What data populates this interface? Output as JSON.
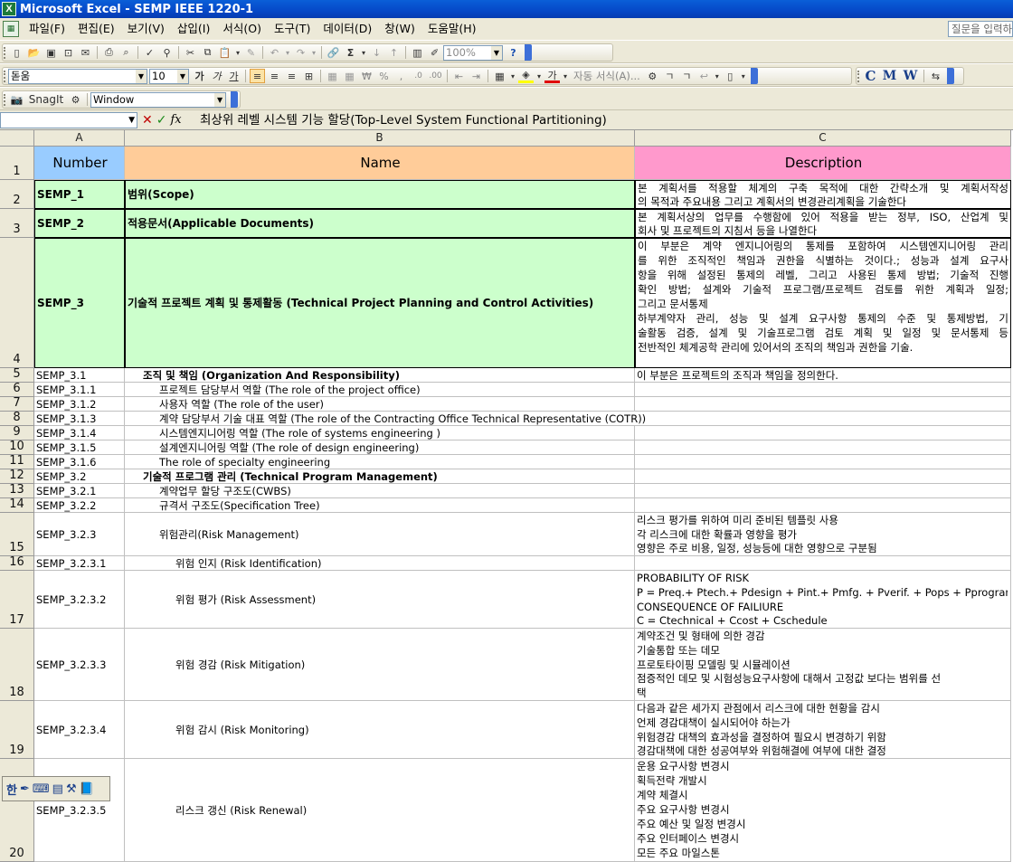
{
  "window": {
    "title": "Microsoft Excel - SEMP IEEE 1220-1"
  },
  "menu": {
    "items": [
      "파일(F)",
      "편집(E)",
      "보기(V)",
      "삽입(I)",
      "서식(O)",
      "도구(T)",
      "데이터(D)",
      "창(W)",
      "도움말(H)"
    ],
    "help_placeholder": "질문을 입력하"
  },
  "toolbar": {
    "zoom": "100%",
    "font": "돋움",
    "font_size": "10",
    "style_bold": "가",
    "style_italic": "가",
    "style_underline": "가",
    "currency": "₩",
    "percent": "%",
    "font_color_glyph": "가",
    "auto_format": "자동 서식(A)...",
    "cmw": [
      "C",
      "M",
      "W"
    ],
    "snagit_label": "SnagIt",
    "snagit_combo": "Window"
  },
  "formula_bar": {
    "name_box": "",
    "content": "최상위 레벨 시스템 기능 할당(Top-Level System Functional Partitioning)"
  },
  "columns": [
    "A",
    "B",
    "C"
  ],
  "header_row": {
    "number": "Number",
    "name": "Name",
    "description": "Description"
  },
  "colors": {
    "header_a": "#99ccff",
    "header_b": "#ffcc99",
    "header_c": "#ff99cc",
    "top_rows": "#ccffcc"
  },
  "rows": [
    {
      "row": "2",
      "number": "SEMP_1",
      "name": "범위(Scope)",
      "desc": [
        "본 계획서를 적용할 체계의 구축 목적에 대한 간략소개 및 계획서작성",
        "의 목적과 주요내용 그리고 계획서의 변경관리계획을 기술한다"
      ]
    },
    {
      "row": "3",
      "number": "SEMP_2",
      "name": "적용문서(Applicable Documents)",
      "desc": [
        "본 계획서상의 업무를 수행함에 있어 적용을 받는 정부, ISO, 산업계 및",
        "회사 및 프로젝트의 지침서 등을 나열한다"
      ]
    },
    {
      "row": "4",
      "number": "SEMP_3",
      "name": "기술적 프로젝트 계획 및 통제활동 (Technical Project Planning and Control Activities)",
      "desc": [
        "이 부분은 계약 엔지니어링의 통제를 포함하여 시스템엔지니어링 관리",
        "를 위한 조직적인 책임과 권한을 식별하는 것이다.; 성능과 설계 요구사",
        "항을 위해 설정된 통제의 레벨, 그리고 사용된 통제 방법; 기술적 진행",
        "확인 방법; 설계와 기술적 프로그램/프로젝트 검토를 위한 계획과 일정;",
        "그리고 문서통제",
        "하부계약자 관리, 성능 및 설계 요구사항 통제의 수준 및 통제방법, 기",
        "술활동 검증, 설계 및 기술프로그램 검토 계획 및 일정 및 문서통제 등",
        "전반적인 체계공학 관리에 있어서의  조직의 책임과 권한을 기술."
      ]
    },
    {
      "row": "5",
      "number": "SEMP_3.1",
      "name": "조직 및 책임 (Organization And Responsibility)",
      "desc": [
        "이 부분은 프로젝트의 조직과 책임을 정의한다."
      ]
    },
    {
      "row": "6",
      "number": "SEMP_3.1.1",
      "name": "프로젝트 담당부서 역할 (The role of the project office)",
      "desc": []
    },
    {
      "row": "7",
      "number": "SEMP_3.1.2",
      "name": "사용자 역할 (The role of the user)",
      "desc": []
    },
    {
      "row": "8",
      "number": "SEMP_3.1.3",
      "name": "계약 담당부서 기술 대표 역할 (The role of the Contracting Office Technical Representative (COTR))",
      "desc": []
    },
    {
      "row": "9",
      "number": "SEMP_3.1.4",
      "name": "시스템엔지니어링 역할 (The role of systems engineering )",
      "desc": []
    },
    {
      "row": "10",
      "number": "SEMP_3.1.5",
      "name": "설계엔지니어링 역할 (The role of design engineering)",
      "desc": []
    },
    {
      "row": "11",
      "number": "SEMP_3.1.6",
      "name": "The role of specialty engineering",
      "desc": []
    },
    {
      "row": "12",
      "number": "SEMP_3.2",
      "name": "기술적 프로그램 관리 (Technical Program Management)",
      "desc": []
    },
    {
      "row": "13",
      "number": "SEMP_3.2.1",
      "name": "계약업무 할당 구조도(CWBS)",
      "desc": []
    },
    {
      "row": "14",
      "number": "SEMP_3.2.2",
      "name": "규격서 구조도(Specification Tree)",
      "desc": []
    },
    {
      "row": "15",
      "number": "SEMP_3.2.3",
      "name": "위험관리(Risk Management)",
      "desc": [
        "리스크 평가를 위하여 미리 준비된 템플릿 사용",
        "각 리스크에 대한 확률과 영향을 평가",
        "영향은 주로 비용, 일정, 성능등에 대한 영향으로 구분됨"
      ]
    },
    {
      "row": "16",
      "number": "SEMP_3.2.3.1",
      "name": "위험 인지 (Risk Identification)",
      "desc": []
    },
    {
      "row": "17",
      "number": "SEMP_3.2.3.2",
      "name": "위험 평가 (Risk Assessment)",
      "desc": [
        "PROBABILITY OF RISK",
        "    P = Preq.+ Ptech.+ Pdesign + Pint.+ Pmfg. + Pverif. + Pops + Pprogram",
        "CONSEQUENCE OF FAILIURE",
        "    C = Ctechnical + Ccost + Cschedule"
      ]
    },
    {
      "row": "18",
      "number": "SEMP_3.2.3.3",
      "name": "위험 경감 (Risk Mitigation)",
      "desc": [
        "계약조건 및 형태에 의한 경감",
        "기술통합 또는 데모",
        "프로토타이핑 모델링 및 시뮬레이션",
        "점증적인 데모 및 시험성능요구사항에 대해서 고정값 보다는 범위를 선",
        "택"
      ]
    },
    {
      "row": "19",
      "number": "SEMP_3.2.3.4",
      "name": "위험 감시 (Risk Monitoring)",
      "desc": [
        "다음과 같은 세가지 관점에서 리스크에 대한 현황을 감시",
        "언제 경감대책이 실시되어야 하는가",
        "위험경감 대책의 효과성을 결정하여 필요시 변경하기 위함",
        "경감대책에 대한 성공여부와 위험해결에 여부에 대한 결정"
      ]
    },
    {
      "row": "20",
      "number": "SEMP_3.2.3.5",
      "name": "리스크 갱신 (Risk Renewal)",
      "desc": [
        "운용 요구사항 변경시",
        "획득전략 개발시",
        "계약 체결시",
        "주요 요구사항 변경시",
        "주요 예산 및 일정 변경시",
        "주요 인터페이스 변경시",
        "모든 주요 마일스톤"
      ]
    }
  ],
  "floating_toolbar": {
    "label": "한"
  }
}
